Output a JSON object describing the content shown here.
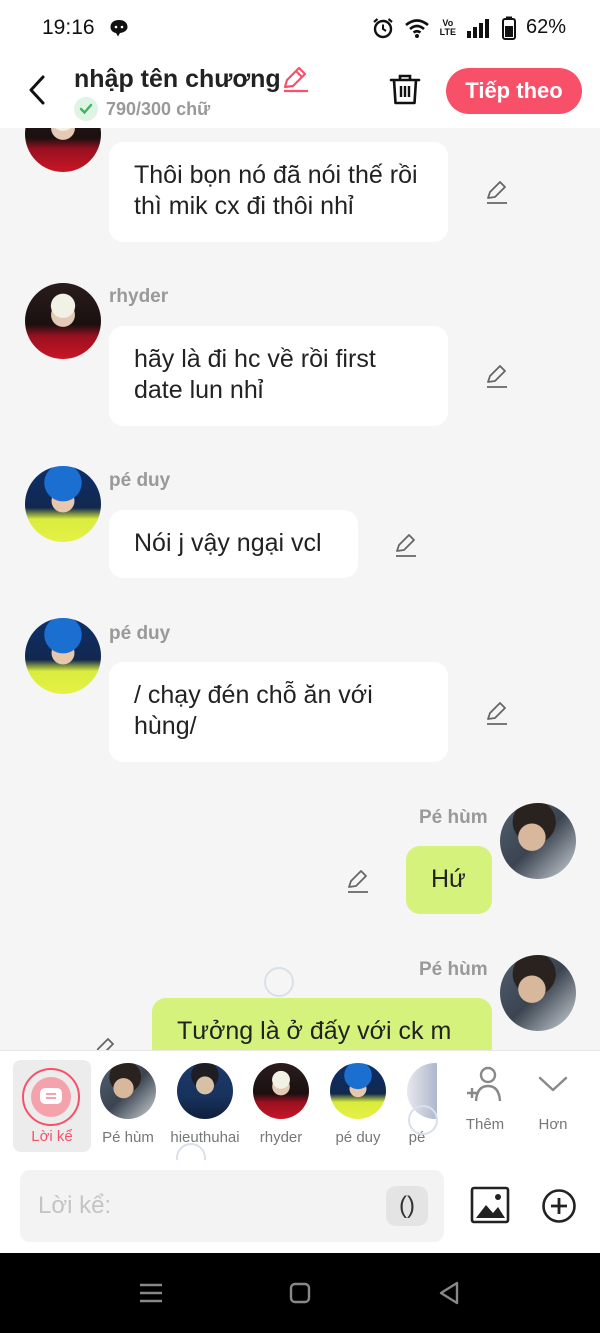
{
  "status_bar": {
    "time": "19:16",
    "battery": "62%",
    "volte_line1": "Vo",
    "volte_line2": "LTE"
  },
  "header": {
    "title": "nhập tên chương",
    "word_count": "790/300 chữ",
    "next_label": "Tiếp theo",
    "accent_color": "#f9506a"
  },
  "messages": [
    {
      "sender": "",
      "text": "Thôi bọn nó đã nói thế rồi thì mik cx đi thôi nhỉ",
      "side": "left",
      "avatar": "rhyder"
    },
    {
      "sender": "rhyder",
      "text": "hãy là đi hc về rồi first date lun nhỉ",
      "side": "left",
      "avatar": "rhyder"
    },
    {
      "sender": "pé duy",
      "text": "Nói j vậy ngại vcl",
      "side": "left",
      "avatar": "pe-duy"
    },
    {
      "sender": "pé duy",
      "text": "/ chạy đén chỗ ăn với hùng/",
      "side": "left",
      "avatar": "pe-duy"
    },
    {
      "sender": "Pé hùm",
      "text": "Hứ",
      "side": "right",
      "avatar": "pe-hum"
    },
    {
      "sender": "Pé hùm",
      "text": "Tưởng là ở đấy với ck m",
      "side": "right",
      "avatar": "pe-hum"
    }
  ],
  "characters": {
    "narrator": "Lời kể",
    "items": [
      "Pé hùm",
      "hieuthuhai",
      "rhyder",
      "pé duy",
      "pé"
    ],
    "add_label": "Thêm",
    "more_label": "Hơn"
  },
  "input": {
    "placeholder": "Lời kể:",
    "paren": "()"
  },
  "colors": {
    "mine_bubble": "#d4f27c",
    "background": "#f5f5f5"
  }
}
